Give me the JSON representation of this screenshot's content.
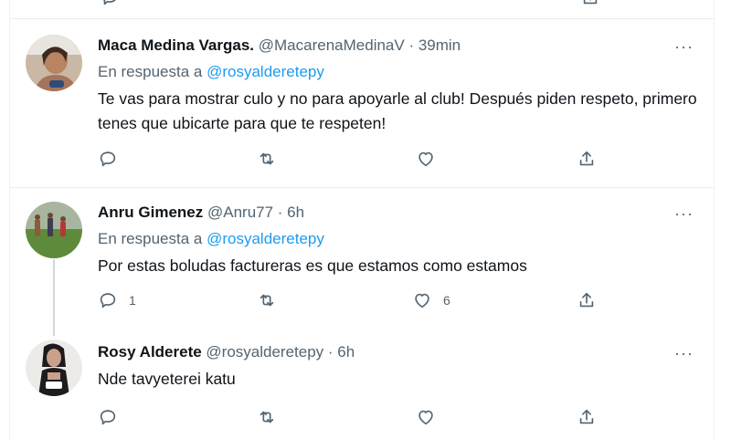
{
  "tweets": [
    {
      "name": "Maca Medina Vargas.",
      "handle": "@MacarenaMedinaV",
      "time": "· 39min",
      "reply_prefix": "En respuesta a",
      "reply_to": "@rosyalderetepy",
      "text": "Te vas para mostrar culo y no para apoyarle al club! Después piden respeto, primero tenes que ubicarte para que te respeten!",
      "more": "···",
      "stats": {
        "replies": "",
        "retweets": "",
        "likes": ""
      }
    },
    {
      "name": "Anru Gimenez",
      "handle": "@Anru77",
      "time": "· 6h",
      "reply_prefix": "En respuesta a",
      "reply_to": "@rosyalderetepy",
      "text": "Por estas boludas factureras es que estamos como estamos",
      "more": "···",
      "stats": {
        "replies": "1",
        "retweets": "",
        "likes": "6"
      }
    },
    {
      "name": "Rosy Alderete",
      "handle": "@rosyalderetepy",
      "time": "· 6h",
      "text": "Nde tavyeterei katu",
      "more": "···",
      "stats": {
        "replies": "",
        "retweets": "",
        "likes": ""
      }
    }
  ],
  "icons": {
    "reply": "reply-icon",
    "retweet": "retweet-icon",
    "like": "like-icon",
    "share": "share-icon",
    "more": "more-icon"
  },
  "colors": {
    "link": "#1d9bf0",
    "secondary_text": "#536471",
    "divider": "#e6ecf0"
  }
}
